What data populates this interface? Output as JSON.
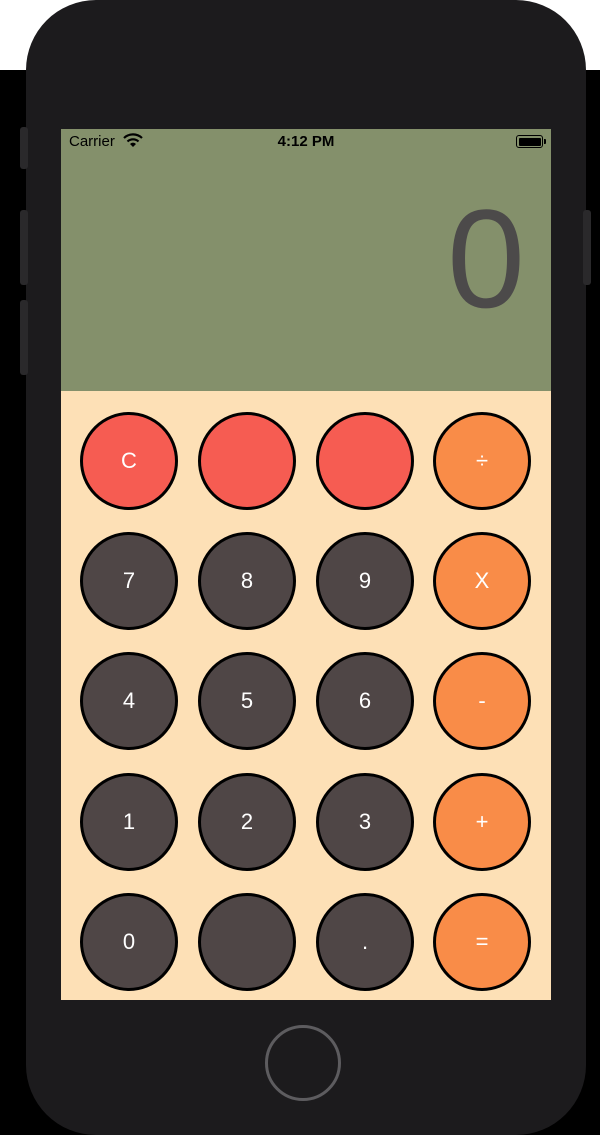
{
  "status_bar": {
    "carrier": "Carrier",
    "time": "4:12 PM",
    "wifi_icon": "wifi-icon",
    "battery_icon": "battery-icon"
  },
  "display": {
    "value": "0"
  },
  "keys": {
    "clear": "C",
    "blank1": "",
    "blank2": "",
    "divide": "÷",
    "seven": "7",
    "eight": "8",
    "nine": "9",
    "multiply": "X",
    "four": "4",
    "five": "5",
    "six": "6",
    "minus": "-",
    "one": "1",
    "two": "2",
    "three": "3",
    "plus": "+",
    "zero": "0",
    "blank3": "",
    "decimal": ".",
    "equals": "="
  },
  "colors": {
    "display_bg": "#84906b",
    "keypad_bg": "#fde0b6",
    "function_key": "#f65c52",
    "number_key": "#4f4646",
    "operator_key": "#f98c48",
    "display_text": "#4c4a4a"
  }
}
